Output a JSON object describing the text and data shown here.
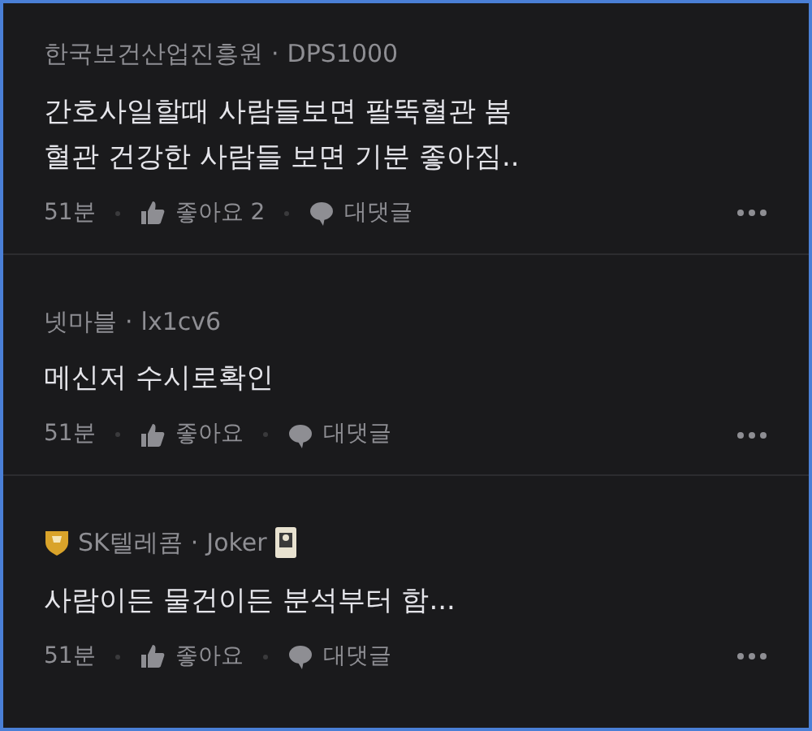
{
  "comments": [
    {
      "company": "한국보건산업진흥원",
      "company_badge": false,
      "separator": "·",
      "nickname": "DPS1000",
      "nickname_badge": false,
      "body": "간호사일할때 사람들보면 팔뚝혈관 봄\n혈관 건강한 사람들 보면 기분 좋아짐..",
      "time": "51분",
      "like": "좋아요 2",
      "reply": "대댓글"
    },
    {
      "company": "넷마블",
      "company_badge": false,
      "separator": "·",
      "nickname": "lx1cv6",
      "nickname_badge": false,
      "body": "메신저 수시로확인",
      "time": "51분",
      "like": "좋아요",
      "reply": "대댓글"
    },
    {
      "company": "SK텔레콤",
      "company_badge": true,
      "separator": "·",
      "nickname": "Joker",
      "nickname_badge": true,
      "body": "사람이든 물건이든 분석부터 함...",
      "time": "51분",
      "like": "좋아요",
      "reply": "대댓글"
    }
  ]
}
